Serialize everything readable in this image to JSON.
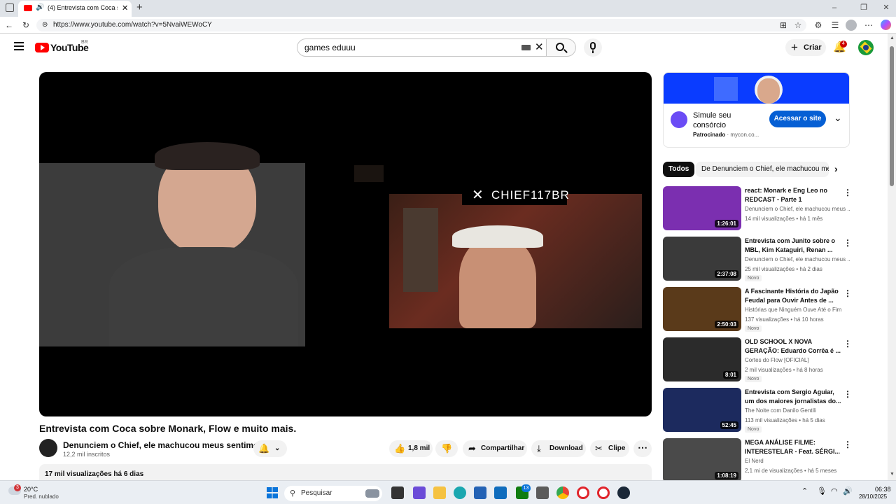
{
  "browser": {
    "tab_title": "(4) Entrevista com Coca sobr...",
    "url": "https://www.youtube.com/watch?v=5NvaiWEWoCY"
  },
  "header": {
    "logo_text": "YouTube",
    "region": "BR",
    "search_value": "games eduuu",
    "create_label": "Criar",
    "notification_count": "4"
  },
  "video": {
    "overlay_text": "CHIEF117BR",
    "title": "Entrevista com Coca sobre Monark, Flow e muito mais.",
    "channel": "Denunciem o Chief, ele machucou meus sentimentos!",
    "subscribers": "12,2 mil inscritos",
    "likes": "1,8 mil",
    "share_label": "Compartilhar",
    "download_label": "Download",
    "clip_label": "Clipe",
    "views_date": "17 mil visualizações  há 6 dias"
  },
  "ad": {
    "title": "Simule seu consórcio",
    "sponsored": "Patrocinado",
    "domain": "mycon.co...",
    "button": "Acessar o site"
  },
  "chips": {
    "all": "Todos",
    "channel": "De Denunciem o Chief, ele machucou meus sentimentos!"
  },
  "recs": [
    {
      "title": "react: Monark e Eng Leo no REDCAST - Parte 1",
      "channel": "Denunciem o Chief, ele machucou meus ...",
      "meta": "14 mil visualizações  •  há 1 mês",
      "duration": "1:26:01",
      "badge": "",
      "thumb_color": "#7b2fb0"
    },
    {
      "title": "Entrevista com Junito sobre o MBL, Kim Kataguiri, Renan ...",
      "channel": "Denunciem o Chief, ele machucou meus ...",
      "meta": "25 mil visualizações  •  há 2 dias",
      "duration": "2:37:08",
      "badge": "Novo",
      "thumb_color": "#3a3a3a"
    },
    {
      "title": "A Fascinante História do Japão Feudal para Ouvir Antes de ...",
      "channel": "Histórias que Ninguém Ouve Até o Fim",
      "meta": "137 visualizações  •  há 10 horas",
      "duration": "2:50:03",
      "badge": "Novo",
      "thumb_color": "#5a3a1a"
    },
    {
      "title": "OLD SCHOOL X NOVA GERAÇÃO: Eduardo Corrêa é ...",
      "channel": "Cortes do Flow [OFICIAL]",
      "meta": "2 mil visualizações  •  há 8 horas",
      "duration": "8:01",
      "badge": "Novo",
      "thumb_color": "#2b2b2b"
    },
    {
      "title": "Entrevista com Sergio Aguiar, um dos maiores jornalistas do...",
      "channel": "The Noite com Danilo Gentili",
      "meta": "113 mil visualizações  •  há 5 dias",
      "duration": "52:45",
      "badge": "Novo",
      "thumb_color": "#1c2a5e"
    },
    {
      "title": "MEGA ANÁLISE FILME: INTERESTELAR - Feat. SÉRGI...",
      "channel": "El Nerd",
      "meta": "2,1 mi de visualizações  •  há 5 meses",
      "duration": "1:08:19",
      "badge": "",
      "thumb_color": "#4a4a4a"
    }
  ],
  "taskbar": {
    "temp": "20°C",
    "weather": "Pred. nublado",
    "search_placeholder": "Pesquisar",
    "time": "06:38",
    "date": "28/10/2025",
    "weather_badge": "3",
    "store_badge": "13"
  }
}
